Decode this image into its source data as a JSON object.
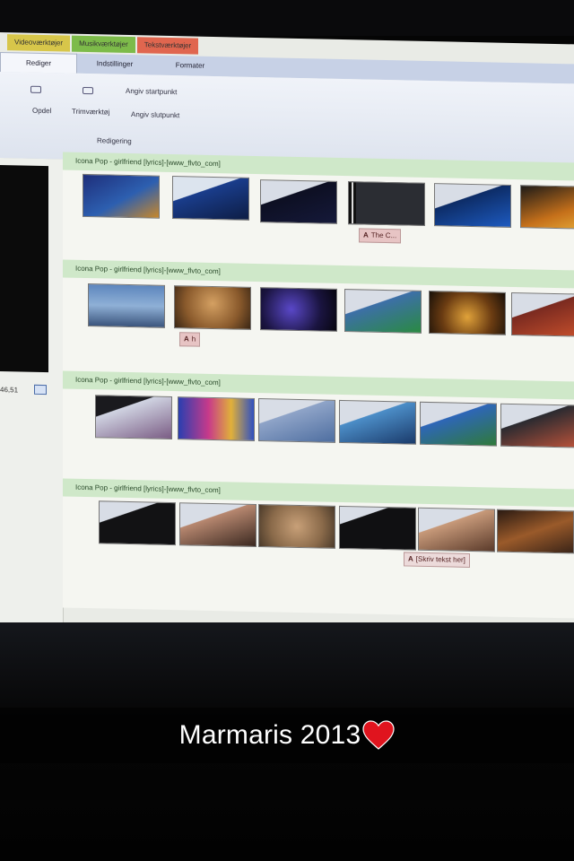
{
  "photo": {
    "description_free": true,
    "tool_tabs": [
      "Videoværktøjer",
      "Musikværktøjer",
      "Tekstværktøjer"
    ],
    "tabs": [
      "Rediger",
      "Indstillinger",
      "Formater"
    ],
    "ribbon": {
      "split": "Opdel",
      "trim_tool": "Trimværktøj",
      "set_start": "Angiv startpunkt",
      "set_end": "Angiv slutpunkt",
      "group": "Redigering"
    },
    "time_readout": "46,51",
    "tracks": [
      "Icona Pop - girlfriend [lyrics]-[www_flvto_com]",
      "Icona Pop - girlfriend [lyrics]-[www_flvto_com]",
      "Icona Pop - girlfriend [lyrics]-[www_flvto_com]",
      "Icona Pop - girlfriend [lyrics]-[www_flvto_com]"
    ],
    "captions": {
      "c1_letter": "A",
      "c1_text": "The C...",
      "c2_letter": "A",
      "c2_text": "h",
      "c3_letter": "A",
      "c3_text": "[Skriv tekst her]"
    }
  },
  "snap_caption": {
    "text": "Marmaris 2013",
    "emoji_icon": "heart-icon",
    "emoji_color": "#e0141e"
  }
}
